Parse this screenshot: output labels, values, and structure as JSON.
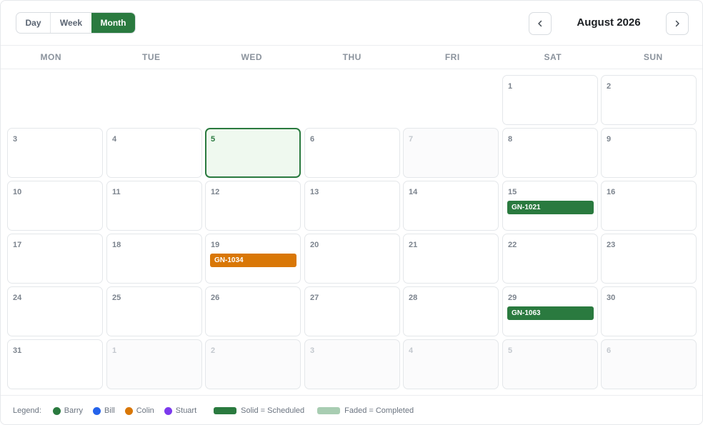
{
  "header": {
    "views": [
      {
        "label": "Day",
        "active": false
      },
      {
        "label": "Week",
        "active": false
      },
      {
        "label": "Month",
        "active": true
      }
    ],
    "month_title": "August 2026"
  },
  "weekdays": [
    "MON",
    "TUE",
    "WED",
    "THU",
    "FRI",
    "SAT",
    "SUN"
  ],
  "weeks": [
    [
      null,
      null,
      null,
      null,
      null,
      {
        "day": "1"
      },
      {
        "day": "2"
      }
    ],
    [
      {
        "day": "3"
      },
      {
        "day": "4"
      },
      {
        "day": "5",
        "today": true
      },
      {
        "day": "6"
      },
      {
        "day": "7",
        "shaded": true
      },
      {
        "day": "8"
      },
      {
        "day": "9"
      }
    ],
    [
      {
        "day": "10"
      },
      {
        "day": "11"
      },
      {
        "day": "12"
      },
      {
        "day": "13"
      },
      {
        "day": "14"
      },
      {
        "day": "15",
        "event": {
          "label": "GN-1021",
          "color": "#2a7a3f"
        }
      },
      {
        "day": "16"
      }
    ],
    [
      {
        "day": "17"
      },
      {
        "day": "18"
      },
      {
        "day": "19",
        "event": {
          "label": "GN-1034",
          "color": "#d97706"
        }
      },
      {
        "day": "20"
      },
      {
        "day": "21"
      },
      {
        "day": "22"
      },
      {
        "day": "23"
      }
    ],
    [
      {
        "day": "24"
      },
      {
        "day": "25"
      },
      {
        "day": "26"
      },
      {
        "day": "27"
      },
      {
        "day": "28"
      },
      {
        "day": "29",
        "event": {
          "label": "GN-1063",
          "color": "#2a7a3f"
        }
      },
      {
        "day": "30"
      }
    ],
    [
      {
        "day": "31"
      },
      {
        "day": "1",
        "other": true
      },
      {
        "day": "2",
        "other": true
      },
      {
        "day": "3",
        "other": true
      },
      {
        "day": "4",
        "other": true
      },
      {
        "day": "5",
        "other": true
      },
      {
        "day": "6",
        "other": true
      }
    ]
  ],
  "legend": {
    "label": "Legend:",
    "people": [
      {
        "name": "Barry",
        "color": "#2a7a3f"
      },
      {
        "name": "Bill",
        "color": "#2563eb"
      },
      {
        "name": "Colin",
        "color": "#d97706"
      },
      {
        "name": "Stuart",
        "color": "#7c3aed"
      }
    ],
    "styles": [
      {
        "label": "Solid = Scheduled",
        "color": "#2a7a3f"
      },
      {
        "label": "Faded = Completed",
        "color": "#a8cdb2"
      }
    ]
  }
}
